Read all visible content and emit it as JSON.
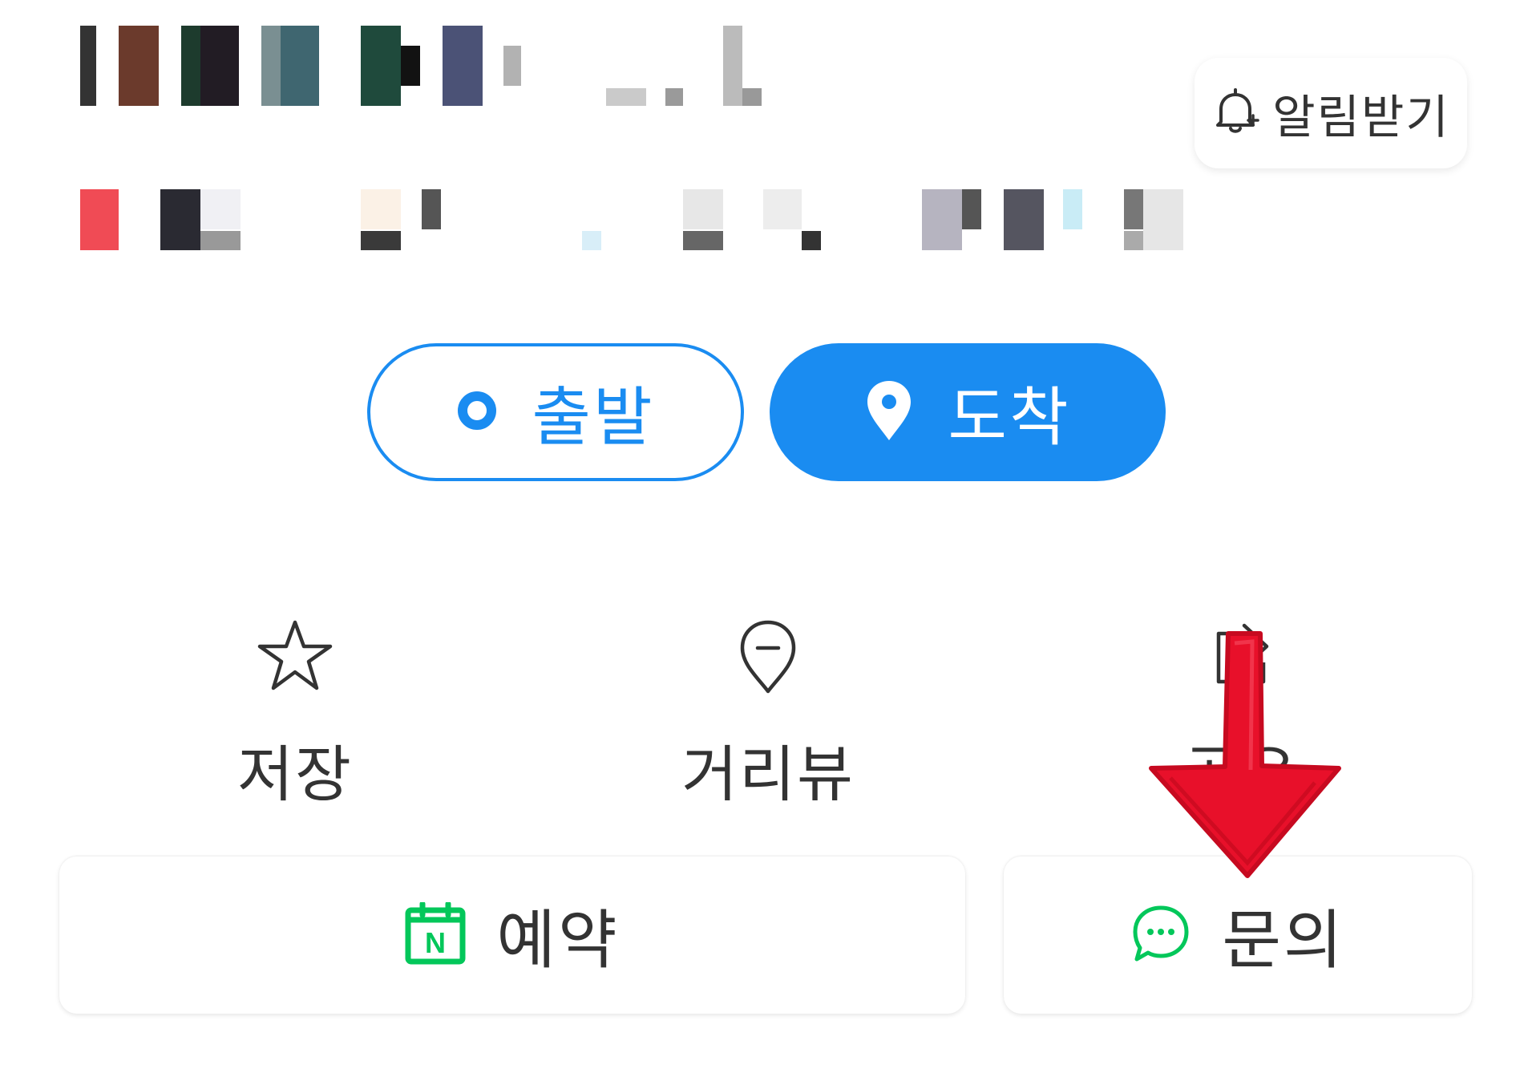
{
  "header": {
    "notify_button": {
      "label": "알림받기",
      "icon": "bell-icon"
    }
  },
  "route": {
    "start_label": "출발",
    "end_label": "도착",
    "accent_color": "#1a8cf1"
  },
  "actions": [
    {
      "label": "저장",
      "icon": "star-icon"
    },
    {
      "label": "거리뷰",
      "icon": "street-view-icon"
    },
    {
      "label": "공유",
      "icon": "share-icon"
    }
  ],
  "bottom": {
    "booking_label": "예약",
    "booking_icon": "naver-booking-icon",
    "inquiry_label": "문의",
    "inquiry_icon": "chat-bubble-icon",
    "brand_color": "#03c75a"
  },
  "annotation": {
    "icon": "red-arrow-down",
    "color": "#e8102a"
  }
}
